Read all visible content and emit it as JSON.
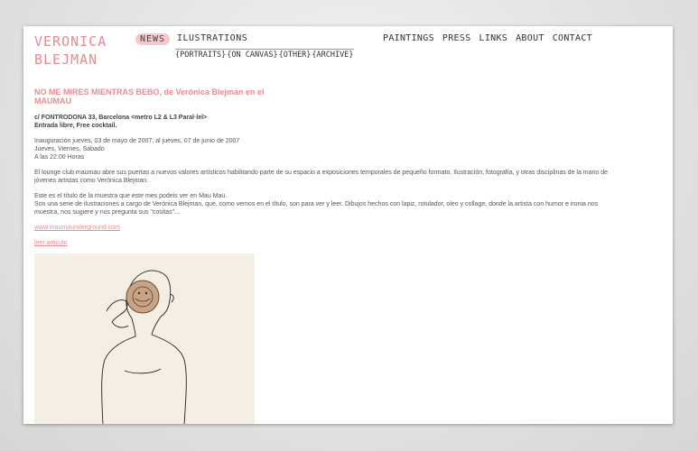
{
  "logo": {
    "line1": "VERONICA",
    "line2": "BLEJMAN"
  },
  "nav": {
    "news": "NEWS",
    "illustrations": "ILUSTRATIONS",
    "sub": [
      "{PORTRAITS}",
      "{ON CANVAS}",
      "{OTHER}",
      "{ARCHIVE}"
    ],
    "right": [
      "PAINTINGS",
      "PRESS",
      "LINKS",
      "ABOUT",
      "CONTACT"
    ]
  },
  "article": {
    "title": "NO ME MIRES MIENTRAS BEBO, de Verónica Blejman en el MAUMAU",
    "address_line1": "c/ FONTRODONA 33, Barcelona <metro L2 & L3 Paral·lel>",
    "address_line2": "Entrada libre, Free cocktail.",
    "dates": [
      "Inauguración jueves, 03 de mayo de 2007; al jueves, 07 de junio de 2007",
      "Jueves, Viernes, Sábado",
      "A las 22:00 Horas"
    ],
    "para1": "El lounge club maumau abre sus puertas a nuevos valores artísticos habilitando parte de su espacio a exposiciones temporales de pequeño formato. Ilustración, fotografía, y otras disciplinas de la mano de jóvenes artistas como Verónica Blejman.",
    "para2_line1": "Este es el título de la muestra que este mes podeis ver en Mau Mau.",
    "para2_line2": "Son una serie de ilustraciones a cargo de Verónica Blejman, que, como vemos en el título, son para ver y leer. Dibujos hechos con lapiz, rotulador, oleo y collage, donde la artista con humor e ironia nos muestra, nos sugiere y nos pregunta sus \"cositas\"...",
    "link1": "www.maumaunderground.com",
    "link2": "leer artículo"
  }
}
